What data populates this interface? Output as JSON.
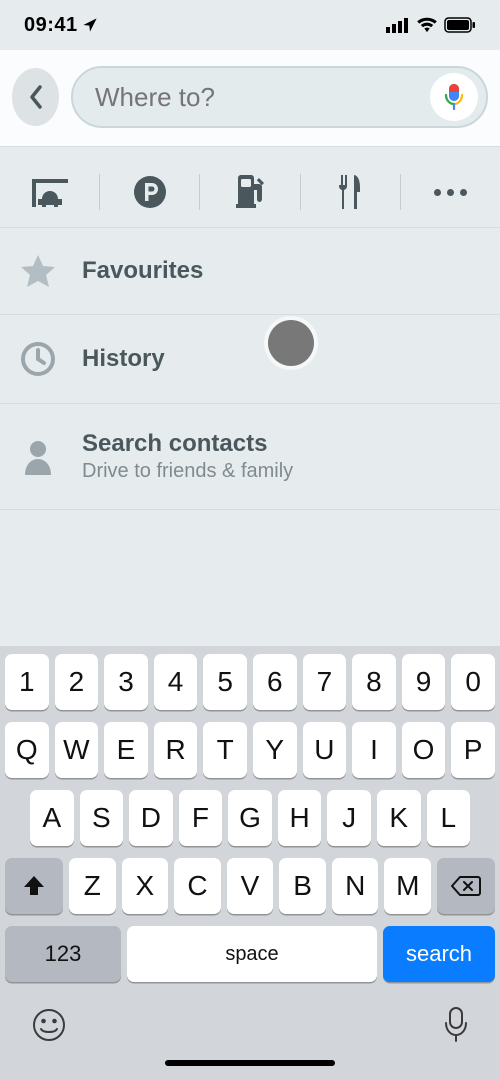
{
  "status": {
    "time": "09:41"
  },
  "search": {
    "placeholder": "Where to?"
  },
  "categories": {
    "items": [
      "garage",
      "parking",
      "gas",
      "food",
      "more"
    ]
  },
  "list": {
    "favourites": {
      "label": "Favourites"
    },
    "history": {
      "label": "History"
    },
    "contacts": {
      "title": "Search contacts",
      "subtitle": "Drive to friends & family"
    }
  },
  "keyboard": {
    "row_num": [
      "1",
      "2",
      "3",
      "4",
      "5",
      "6",
      "7",
      "8",
      "9",
      "0"
    ],
    "row_q": [
      "Q",
      "W",
      "E",
      "R",
      "T",
      "Y",
      "U",
      "I",
      "O",
      "P"
    ],
    "row_a": [
      "A",
      "S",
      "D",
      "F",
      "G",
      "H",
      "J",
      "K",
      "L"
    ],
    "row_z": [
      "Z",
      "X",
      "C",
      "V",
      "B",
      "N",
      "M"
    ],
    "key_123": "123",
    "key_space": "space",
    "key_search": "search"
  },
  "colors": {
    "accent": "#0a7cff",
    "muted": "#4a575d"
  }
}
